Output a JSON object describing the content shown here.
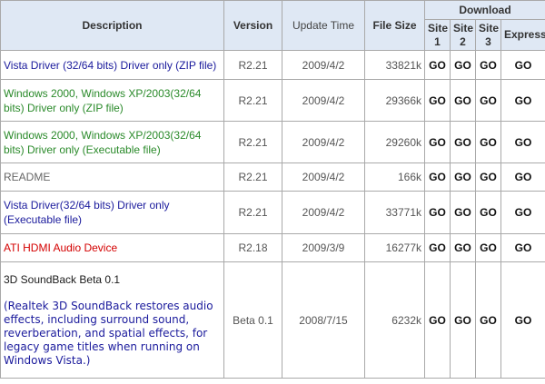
{
  "headers": {
    "description": "Description",
    "version": "Version",
    "update_time": "Update Time",
    "file_size": "File Size",
    "download": "Download",
    "sites": [
      "Site 1",
      "Site 2",
      "Site 3",
      "Express"
    ]
  },
  "go_label": "GO",
  "rows": [
    {
      "description": "Vista Driver (32/64 bits) Driver only (ZIP file)",
      "version": "R2.21",
      "date": "2009/4/2",
      "size": "33821k"
    },
    {
      "description": "Windows 2000, Windows XP/2003(32/64 bits) Driver only (ZIP file)",
      "version": "R2.21",
      "date": "2009/4/2",
      "size": "29366k"
    },
    {
      "description": "Windows 2000, Windows XP/2003(32/64 bits) Driver only (Executable file)",
      "version": "R2.21",
      "date": "2009/4/2",
      "size": "29260k"
    },
    {
      "description": "README",
      "version": "R2.21",
      "date": "2009/4/2",
      "size": "166k"
    },
    {
      "description": "Vista Driver(32/64 bits) Driver only (Executable file)",
      "version": "R2.21",
      "date": "2009/4/2",
      "size": "33771k"
    },
    {
      "description": "ATI HDMI Audio Device",
      "version": "R2.18",
      "date": "2009/3/9",
      "size": "16277k"
    },
    {
      "description": "3D SoundBack Beta 0.1",
      "note": "(Realtek 3D SoundBack restores audio effects, including surround sound, reverberation, and spatial effects, for legacy game titles when running on Windows Vista.)",
      "version": "Beta 0.1",
      "date": "2008/7/15",
      "size": "6232k"
    }
  ],
  "colors": {
    "header_bg": "#dfe8f4",
    "border": "#a9a9a9",
    "blue_text": "#1a1a9c",
    "green_text": "#2a8a2a",
    "red_text": "#d40000",
    "gray_text": "#666666"
  }
}
